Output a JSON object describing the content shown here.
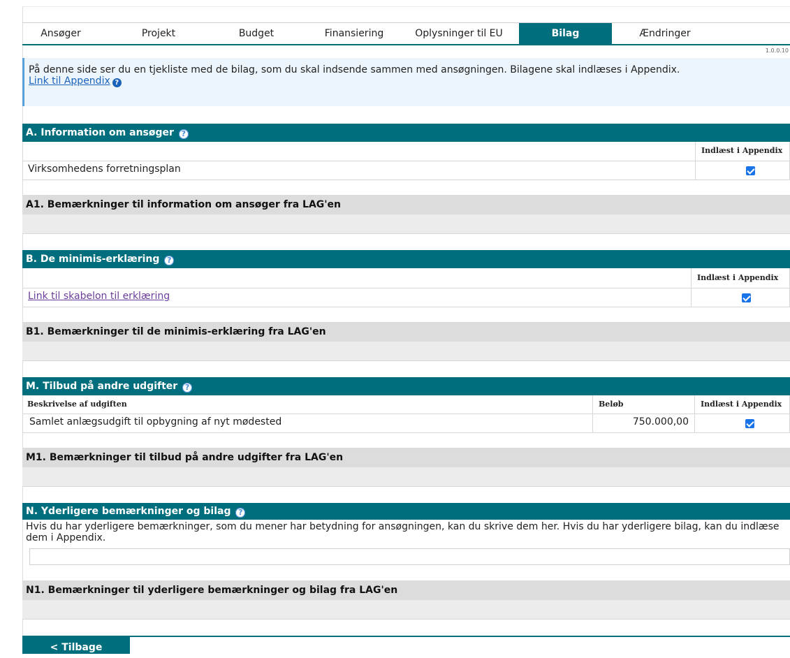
{
  "tabs": [
    "Ansøger",
    "Projekt",
    "Budget",
    "Finansiering",
    "Oplysninger til EU",
    "Bilag",
    "Ændringer"
  ],
  "active_tab": "Bilag",
  "version": "1.0.0.10",
  "info": {
    "text": "På denne side ser du en tjekliste med de bilag, som du skal indsende sammen med ansøgningen. Bilagene skal indlæses i Appendix.",
    "link": "Link til Appendix"
  },
  "section_a": {
    "title": "A. Information om ansøger",
    "col_header": "Indlæst i Appendix",
    "row_label": "Virksomhedens forretningsplan",
    "checked": true
  },
  "section_a1": {
    "title": "A1. Bemærkninger til information om ansøger fra LAG'en"
  },
  "section_b": {
    "title": "B. De minimis-erklæring",
    "col_header": "Indlæst i Appendix",
    "row_link": "Link til skabelon til erklæring",
    "checked": true
  },
  "section_b1": {
    "title": "B1. Bemærkninger til de minimis-erklæring fra LAG'en"
  },
  "section_m": {
    "title": "M. Tilbud på andre udgifter",
    "col_desc": "Beskrivelse af udgiften",
    "col_amount": "Beløb",
    "col_appendix": "Indlæst i Appendix",
    "row_desc": "Samlet anlægsudgift til opbygning af nyt mødested",
    "row_amount": "750.000,00",
    "checked": true
  },
  "section_m1": {
    "title": "M1. Bemærkninger til tilbud på andre udgifter fra LAG'en"
  },
  "section_n": {
    "title": "N. Yderligere bemærkninger og bilag",
    "text": "Hvis du har yderligere bemærkninger, som du mener har betydning for ansøgningen, kan du skrive dem her. Hvis du har yderligere bilag, kan du indlæse dem i Appendix.",
    "input_value": ""
  },
  "section_n1": {
    "title": "N1. Bemærkninger til yderligere bemærkninger og bilag fra LAG'en"
  },
  "back_button": "< Tilbage",
  "icons": {
    "help": "help-icon",
    "checkbox": "checkbox-checked-icon"
  },
  "colors": {
    "accent": "#006e7c",
    "info_bg": "#ecf5fc",
    "checkbox": "#1a73e8"
  }
}
